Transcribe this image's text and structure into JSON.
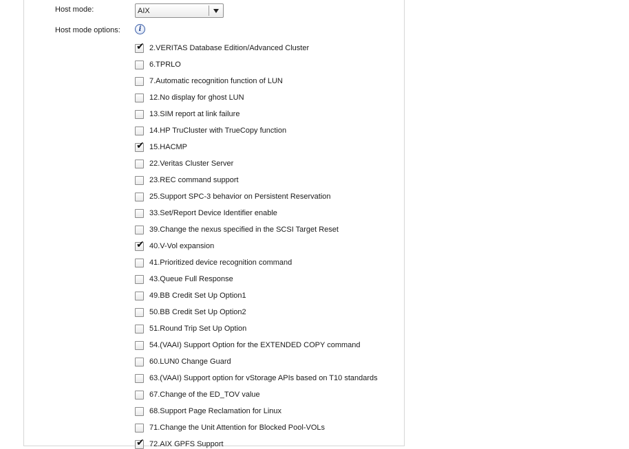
{
  "host_mode": {
    "label": "Host mode:",
    "selected": "AIX"
  },
  "host_mode_options": {
    "label": "Host mode options:",
    "info_icon": "info-icon",
    "items": [
      {
        "label": "2.VERITAS Database Edition/Advanced Cluster",
        "checked": true
      },
      {
        "label": "6.TPRLO",
        "checked": false
      },
      {
        "label": "7.Automatic recognition function of LUN",
        "checked": false
      },
      {
        "label": "12.No display for ghost LUN",
        "checked": false
      },
      {
        "label": "13.SIM report at link failure",
        "checked": false
      },
      {
        "label": "14.HP TruCluster with TrueCopy function",
        "checked": false
      },
      {
        "label": "15.HACMP",
        "checked": true
      },
      {
        "label": "22.Veritas Cluster Server",
        "checked": false
      },
      {
        "label": "23.REC command support",
        "checked": false
      },
      {
        "label": "25.Support SPC-3 behavior on Persistent Reservation",
        "checked": false
      },
      {
        "label": "33.Set/Report Device Identifier enable",
        "checked": false
      },
      {
        "label": "39.Change the nexus specified in the SCSI Target Reset",
        "checked": false
      },
      {
        "label": "40.V-Vol expansion",
        "checked": true
      },
      {
        "label": "41.Prioritized device recognition command",
        "checked": false
      },
      {
        "label": "43.Queue Full Response",
        "checked": false
      },
      {
        "label": "49.BB Credit Set Up Option1",
        "checked": false
      },
      {
        "label": "50.BB Credit Set Up Option2",
        "checked": false
      },
      {
        "label": "51.Round Trip Set Up Option",
        "checked": false
      },
      {
        "label": "54.(VAAI) Support Option for the EXTENDED COPY command",
        "checked": false
      },
      {
        "label": "60.LUN0 Change Guard",
        "checked": false
      },
      {
        "label": "63.(VAAI) Support option for vStorage APIs based on T10 standards",
        "checked": false
      },
      {
        "label": "67.Change of the ED_TOV value",
        "checked": false
      },
      {
        "label": "68.Support Page Reclamation for Linux",
        "checked": false
      },
      {
        "label": "71.Change the Unit Attention for Blocked Pool-VOLs",
        "checked": false
      },
      {
        "label": "72.AIX GPFS Support",
        "checked": true
      }
    ]
  }
}
